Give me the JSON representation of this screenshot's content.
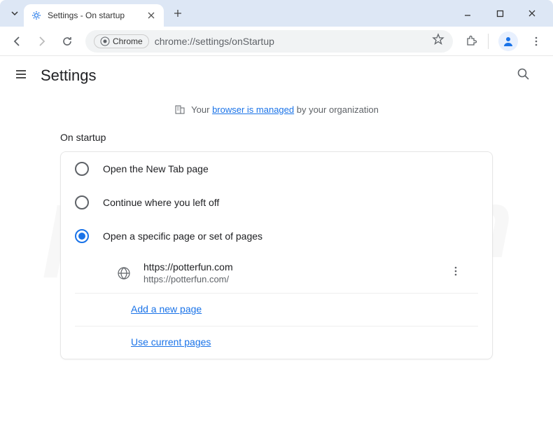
{
  "window": {
    "tab_title": "Settings - On startup"
  },
  "toolbar": {
    "omnibox_badge": "Chrome",
    "url": "chrome://settings/onStartup"
  },
  "header": {
    "title": "Settings"
  },
  "banner": {
    "prefix": "Your ",
    "link": "browser is managed",
    "suffix": " by your organization"
  },
  "section": {
    "title": "On startup"
  },
  "options": {
    "new_tab": "Open the New Tab page",
    "continue": "Continue where you left off",
    "specific": "Open a specific page or set of pages"
  },
  "page_entry": {
    "title": "https://potterfun.com",
    "url": "https://potterfun.com/"
  },
  "links": {
    "add_page": "Add a new page",
    "use_current": "Use current pages"
  }
}
